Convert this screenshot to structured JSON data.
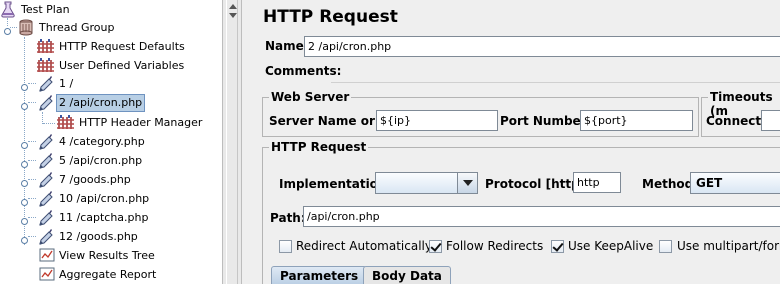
{
  "tree": {
    "nodes": [
      {
        "label": "Test Plan",
        "icon": "test-plan-icon"
      },
      {
        "label": "Thread Group",
        "icon": "thread-group-icon"
      },
      {
        "label": "HTTP Request Defaults",
        "icon": "config-element-icon"
      },
      {
        "label": "User Defined Variables",
        "icon": "config-element-icon"
      },
      {
        "label": "1 /",
        "icon": "sampler-pipette-icon"
      },
      {
        "label": "2 /api/cron.php",
        "icon": "sampler-pipette-icon",
        "selected": true
      },
      {
        "label": "HTTP Header Manager",
        "icon": "config-element-icon"
      },
      {
        "label": "4 /category.php",
        "icon": "sampler-pipette-icon"
      },
      {
        "label": "5 /api/cron.php",
        "icon": "sampler-pipette-icon"
      },
      {
        "label": "7 /goods.php",
        "icon": "sampler-pipette-icon"
      },
      {
        "label": "10 /api/cron.php",
        "icon": "sampler-pipette-icon"
      },
      {
        "label": "11 /captcha.php",
        "icon": "sampler-pipette-icon"
      },
      {
        "label": "12 /goods.php",
        "icon": "sampler-pipette-icon"
      },
      {
        "label": "View Results Tree",
        "icon": "listener-graph-icon"
      },
      {
        "label": "Aggregate Report",
        "icon": "listener-graph-icon"
      }
    ]
  },
  "panel": {
    "title": "HTTP Request",
    "name_label": "Name:",
    "name_value": "2 /api/cron.php",
    "comments_label": "Comments:",
    "web_server": {
      "legend": "Web Server",
      "server_label": "Server Name or IP:",
      "server_value": "${ip}",
      "port_label": "Port Number:",
      "port_value": "${port}"
    },
    "timeouts": {
      "legend": "Timeouts (m",
      "connect_label": "Connect:"
    },
    "http_request": {
      "legend": "HTTP Request",
      "implementation_label": "Implementation:",
      "implementation_value": "",
      "protocol_label": "Protocol [http]:",
      "protocol_value": "http",
      "method_label": "Method:",
      "method_value": "GET",
      "path_label": "Path:",
      "path_value": "/api/cron.php"
    },
    "checkboxes": [
      {
        "label": "Redirect Automatically",
        "checked": false
      },
      {
        "label": "Follow Redirects",
        "checked": true
      },
      {
        "label": "Use KeepAlive",
        "checked": true
      },
      {
        "label": "Use multipart/form",
        "checked": false
      }
    ],
    "tabs": [
      {
        "label": "Parameters",
        "active": true
      },
      {
        "label": "Body Data",
        "active": false
      }
    ]
  }
}
